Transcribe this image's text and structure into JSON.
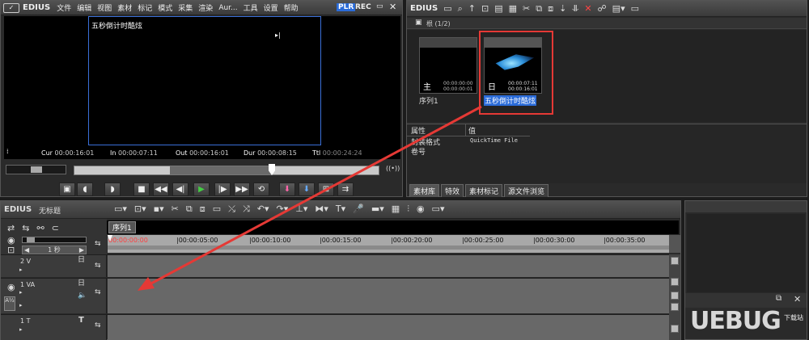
{
  "app": {
    "logo": "EDIUS",
    "icon": "edius-logo-icon"
  },
  "menu": [
    "文件",
    "编辑",
    "视图",
    "素材",
    "标记",
    "模式",
    "采集",
    "渲染",
    "Aur...",
    "工具",
    "设置",
    "帮助"
  ],
  "player": {
    "mode_plr": "PLR",
    "mode_rec": "REC",
    "overlay_title": "五秒倒计时酷炫",
    "cur_label": "Cur",
    "cur_value": "00:00:16:01",
    "in_label": "In",
    "in_value": "00:00:07:11",
    "out_label": "Out",
    "out_value": "00:00:16:01",
    "dur_label": "Dur",
    "dur_value": "00:00:08:15",
    "ttl_label": "Ttl",
    "ttl_value": "00:00:24:24"
  },
  "bin": {
    "logo": "EDIUS",
    "folder_label": "根 (1/2)",
    "clips": [
      {
        "name": "序列1",
        "tc_in": "00:00:00:00",
        "tc_out": "00:00:00:01",
        "selected": false
      },
      {
        "name": "五秒倒计时酷炫",
        "tc_in": "00:00:07:11",
        "tc_out": "00:00:16:01",
        "selected": true
      }
    ],
    "props_header": [
      "属性",
      "值"
    ],
    "props": [
      {
        "key": "封装格式",
        "value": "QuickTime File"
      },
      {
        "key": "卷号",
        "value": ""
      }
    ],
    "tabs": [
      "素材库",
      "特效",
      "素材标记",
      "源文件浏览"
    ]
  },
  "timeline": {
    "logo": "EDIUS",
    "project_name": "无标题",
    "sequence_tab": "序列1",
    "scale_label": "1 秒",
    "ruler": [
      "00:00:00:00",
      "|00:00:05:00",
      "|00:00:10:00",
      "|00:00:15:00",
      "|00:00:20:00",
      "|00:00:25:00",
      "|00:00:30:00",
      "|00:00:35:00"
    ],
    "tracks": [
      {
        "name": "2 V",
        "type": "V"
      },
      {
        "name": "1 VA",
        "type": "VA"
      },
      {
        "name": "1 T",
        "type": "T"
      }
    ]
  },
  "watermark": {
    "text": "UEBUG",
    "sub": "下载站"
  },
  "colors": {
    "highlight_red": "#e53935",
    "in_out_green": "#2fbf2f",
    "selection_blue": "#2a6bd8",
    "timecode_red": "#ff4040"
  }
}
